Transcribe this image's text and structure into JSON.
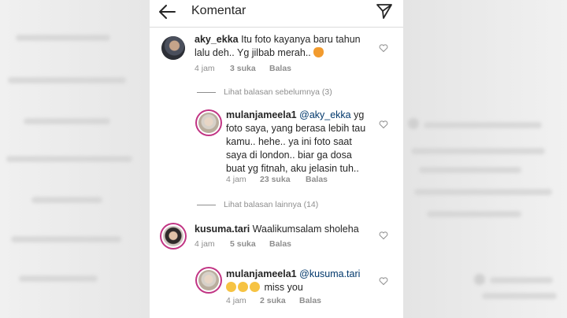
{
  "header": {
    "title": "Komentar"
  },
  "comments": [
    {
      "username": "aky_ekka",
      "line1": "Itu foto kayanya baru tahun",
      "line2": "lalu deh.. Yg jilbab merah..",
      "time": "4 jam",
      "likes": "3 suka",
      "reply": "Balas"
    },
    {
      "username": "mulanjameela1",
      "mention": "@aky_ekka",
      "line1_rest": "yg",
      "line2": "foto saya, yang berasa lebih tau",
      "line3": "kamu.. hehe.. ya ini foto saat",
      "line4": "saya di london.. biar ga dosa",
      "line5": "buat yg fitnah, aku jelasin tuh..",
      "time": "4 jam",
      "likes": "23 suka",
      "reply": "Balas"
    },
    {
      "username": "kusuma.tari",
      "line1": "Waalikumsalam sholeha",
      "time": "4 jam",
      "likes": "5 suka",
      "reply": "Balas"
    },
    {
      "username": "mulanjameela1",
      "mention": "@kusuma.tari",
      "line2": "miss you",
      "time": "4 jam",
      "likes": "2 suka",
      "reply": "Balas"
    }
  ],
  "view_previous": "Lihat balasan sebelumnya (3)",
  "view_more": "Lihat balasan lainnya (14)",
  "colors": {
    "story_ring": "#c13584",
    "mention": "#00376b",
    "meta": "#8e8e8e"
  }
}
